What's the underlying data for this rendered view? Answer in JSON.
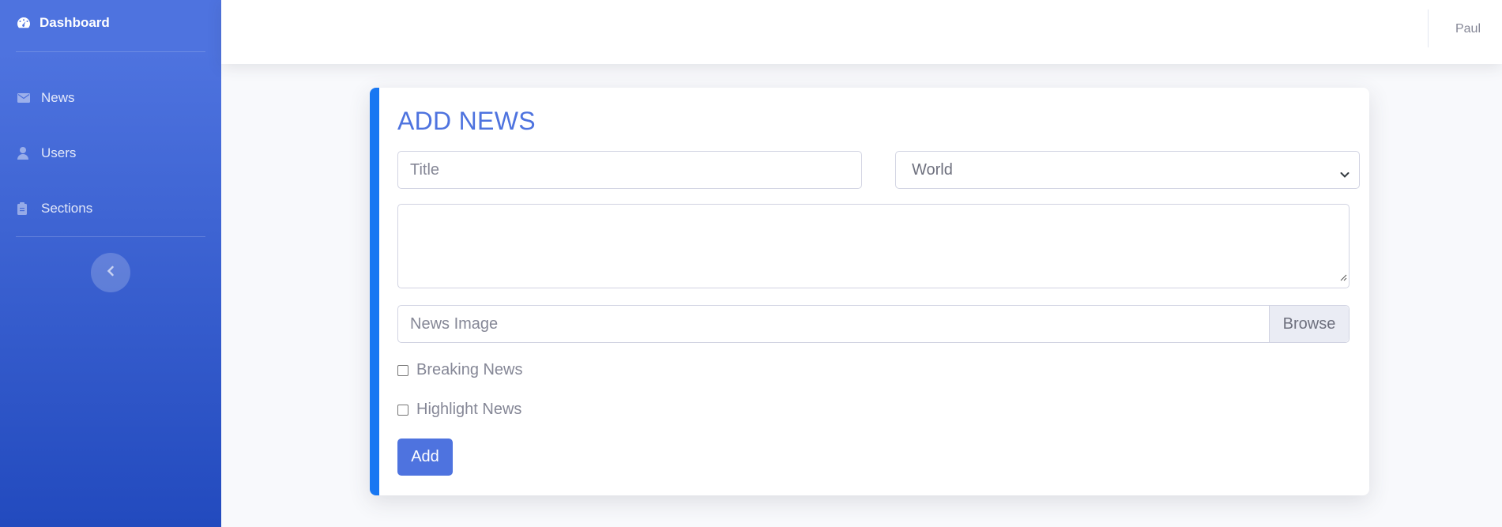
{
  "sidebar": {
    "brand_label": "Dashboard",
    "brand_icon": "tachometer-icon",
    "items": [
      {
        "label": "News",
        "icon": "envelope-icon"
      },
      {
        "label": "Users",
        "icon": "user-icon"
      },
      {
        "label": "Sections",
        "icon": "clipboard-icon"
      }
    ],
    "toggle_icon": "chevron-left-icon"
  },
  "topbar": {
    "user_name": "Paul"
  },
  "form": {
    "title": "ADD NEWS",
    "title_placeholder": "Title",
    "section_selected": "World",
    "body_value": "",
    "file_placeholder": "News Image",
    "browse_label": "Browse",
    "breaking_label": "Breaking News",
    "breaking_checked": false,
    "highlight_label": "Highlight News",
    "highlight_checked": false,
    "submit_label": "Add"
  },
  "colors": {
    "sidebar_start": "#4e73df",
    "sidebar_end": "#224abe",
    "accent": "#4e73df",
    "card_border": "#1877f2"
  }
}
